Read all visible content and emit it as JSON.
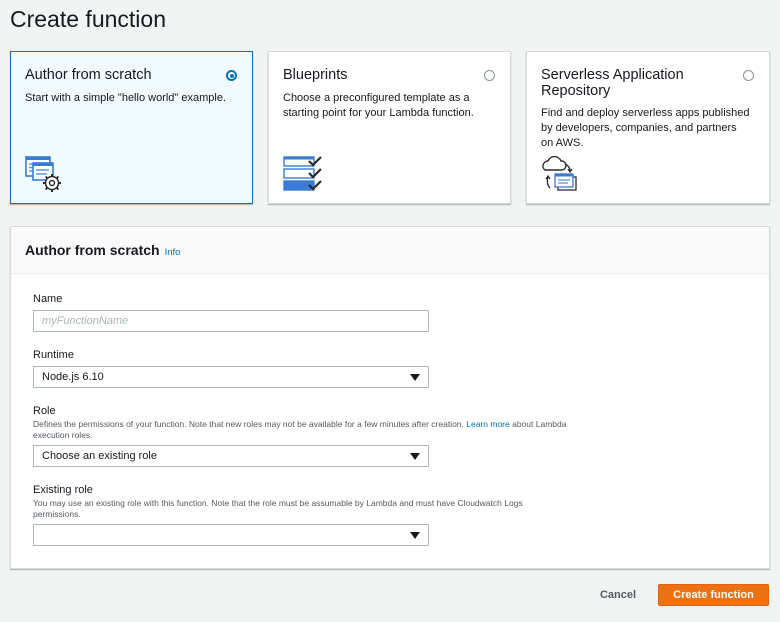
{
  "page": {
    "title": "Create function"
  },
  "options": [
    {
      "title": "Author from scratch",
      "description": "Start with a simple \"hello world\" example.",
      "selected": true
    },
    {
      "title": "Blueprints",
      "description": "Choose a preconfigured template as a starting point for your Lambda function.",
      "selected": false
    },
    {
      "title": "Serverless Application Repository",
      "description": "Find and deploy serverless apps published by developers, companies, and partners on AWS.",
      "selected": false
    }
  ],
  "form": {
    "title": "Author from scratch",
    "info_link": "Info",
    "name": {
      "label": "Name",
      "placeholder": "myFunctionName",
      "value": ""
    },
    "runtime": {
      "label": "Runtime",
      "value": "Node.js 6.10"
    },
    "role": {
      "label": "Role",
      "description": "Defines the permissions of your function. Note that new roles may not be available for a few minutes after creation.",
      "learn_more": "Learn more",
      "description_tail": "about Lambda execution roles.",
      "value": "Choose an existing role"
    },
    "existing_role": {
      "label": "Existing role",
      "description": "You may use an existing role with this function. Note that the role must be assumable by Lambda and must have Cloudwatch Logs permissions.",
      "value": ""
    }
  },
  "actions": {
    "cancel": "Cancel",
    "create": "Create function"
  },
  "colors": {
    "accent": "#0073bb",
    "primary_button": "#ec7211",
    "selected_card_bg": "#f1faff"
  }
}
